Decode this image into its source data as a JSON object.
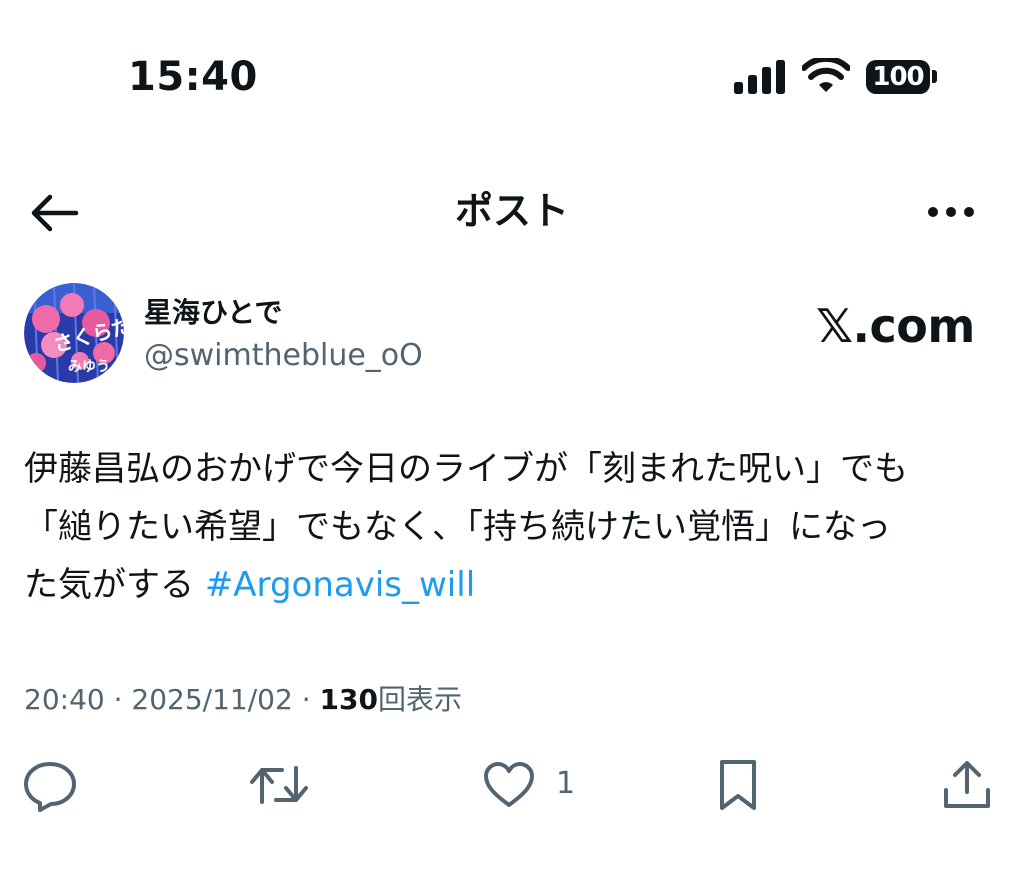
{
  "status_bar": {
    "time": "15:40",
    "battery": "100",
    "icons": [
      "signal-icon",
      "wifi-icon",
      "battery-icon"
    ]
  },
  "header": {
    "title": "ポスト",
    "back_icon": "arrow-left-icon",
    "more_icon": "more-horizontal-icon"
  },
  "author": {
    "name": "星海ひとで",
    "handle": "@swimtheblue_oO",
    "avatar_text": "さくらだ みゆう"
  },
  "brand": {
    "logo": "𝕏.com"
  },
  "post": {
    "lines": [
      "伊藤昌弘のおかげで今日のライブが「刻まれた呪い」でも",
      "「縋りたい希望」でもなく、「持ち続けたい覚悟」になっ",
      "た気がする "
    ],
    "hashtag": "#Argonavis_will"
  },
  "meta": {
    "time": "20:40",
    "separator": "·",
    "date": "2025/11/02",
    "views_count": "130",
    "views_label": "回表示"
  },
  "actions": {
    "reply_icon": "reply-icon",
    "repost_icon": "repost-icon",
    "like_icon": "heart-icon",
    "like_count": "1",
    "bookmark_icon": "bookmark-icon",
    "share_icon": "share-icon"
  },
  "colors": {
    "text": "#0f1419",
    "secondary": "#536471",
    "link": "#1d9bf0",
    "background": "#ffffff"
  }
}
